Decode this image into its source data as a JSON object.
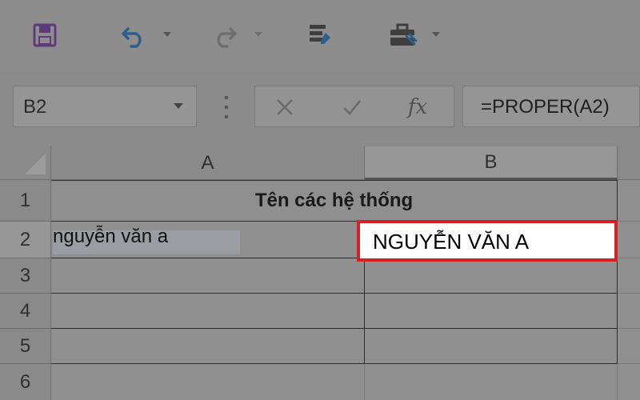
{
  "toolbar": {
    "icons": [
      "save-icon",
      "undo-icon",
      "redo-icon",
      "form-icon",
      "toolbox-icon"
    ]
  },
  "formula_bar": {
    "name_box": "B2",
    "cancel_label": "✕",
    "enter_label": "✓",
    "fx_label": "fx",
    "formula": "=PROPER(A2)"
  },
  "grid": {
    "columns": [
      "A",
      "B"
    ],
    "rows": [
      "1",
      "2",
      "3",
      "4",
      "5",
      "6"
    ],
    "title": "Tên các hệ thống",
    "a2": "nguyễn văn a",
    "b2": "NGUYỄN VĂN A"
  },
  "colors": {
    "active_cell_border": "#d42026",
    "save_icon": "#5d3a7a",
    "undo_icon": "#2f5d8c"
  }
}
